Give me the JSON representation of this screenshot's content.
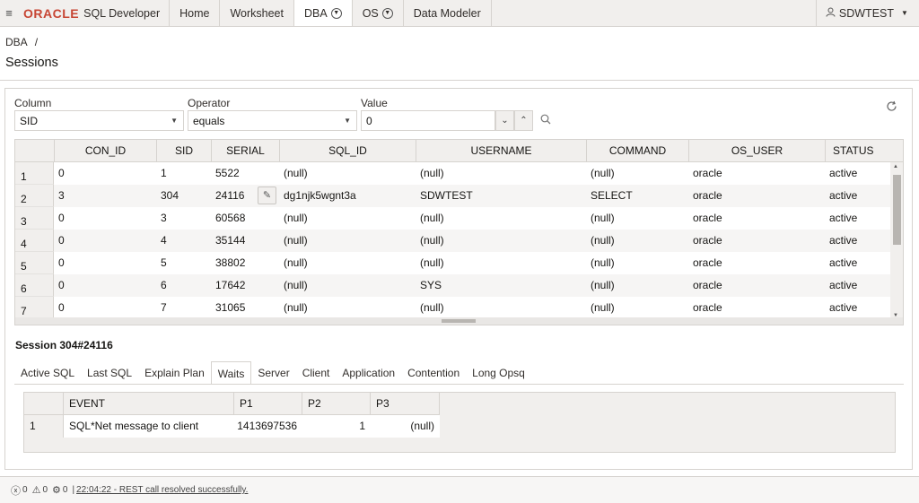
{
  "topbar": {
    "menu_icon": "hamburger-icon",
    "brand": "ORACLE",
    "product": "SQL Developer",
    "tabs": [
      {
        "label": "Home"
      },
      {
        "label": "Worksheet"
      },
      {
        "label": "DBA"
      },
      {
        "label": "OS"
      },
      {
        "label": "Data Modeler"
      }
    ],
    "user": "SDWTEST"
  },
  "breadcrumb": {
    "root": "DBA",
    "separator": "/"
  },
  "page_title": "Sessions",
  "filter": {
    "column_label": "Column",
    "column_value": "SID",
    "operator_label": "Operator",
    "operator_value": "equals",
    "value_label": "Value",
    "value_value": "0"
  },
  "sessions_grid": {
    "columns": [
      "CON_ID",
      "SID",
      "SERIAL",
      "SQL_ID",
      "USERNAME",
      "COMMAND",
      "OS_USER",
      "STATUS"
    ],
    "rows": [
      {
        "num": "1",
        "con_id": "0",
        "sid": "1",
        "serial": "5522",
        "sql_id": "(null)",
        "username": "(null)",
        "command": "(null)",
        "os_user": "oracle",
        "status": "active"
      },
      {
        "num": "2",
        "con_id": "3",
        "sid": "304",
        "serial": "24116",
        "sql_id": "dg1njk5wgnt3a",
        "username": "SDWTEST",
        "command": "SELECT",
        "os_user": "oracle",
        "status": "active"
      },
      {
        "num": "3",
        "con_id": "0",
        "sid": "3",
        "serial": "60568",
        "sql_id": "(null)",
        "username": "(null)",
        "command": "(null)",
        "os_user": "oracle",
        "status": "active"
      },
      {
        "num": "4",
        "con_id": "0",
        "sid": "4",
        "serial": "35144",
        "sql_id": "(null)",
        "username": "(null)",
        "command": "(null)",
        "os_user": "oracle",
        "status": "active"
      },
      {
        "num": "5",
        "con_id": "0",
        "sid": "5",
        "serial": "38802",
        "sql_id": "(null)",
        "username": "(null)",
        "command": "(null)",
        "os_user": "oracle",
        "status": "active"
      },
      {
        "num": "6",
        "con_id": "0",
        "sid": "6",
        "serial": "17642",
        "sql_id": "(null)",
        "username": "SYS",
        "command": "(null)",
        "os_user": "oracle",
        "status": "active"
      },
      {
        "num": "7",
        "con_id": "0",
        "sid": "7",
        "serial": "31065",
        "sql_id": "(null)",
        "username": "(null)",
        "command": "(null)",
        "os_user": "oracle",
        "status": "active"
      }
    ]
  },
  "session_detail": {
    "title": "Session 304#24116",
    "tabs": [
      {
        "label": "Active SQL"
      },
      {
        "label": "Last SQL"
      },
      {
        "label": "Explain Plan"
      },
      {
        "label": "Waits"
      },
      {
        "label": "Server"
      },
      {
        "label": "Client"
      },
      {
        "label": "Application"
      },
      {
        "label": "Contention"
      },
      {
        "label": "Long Opsq"
      }
    ],
    "active_tab": "Waits",
    "waits": {
      "columns": [
        "EVENT",
        "P1",
        "P2",
        "P3"
      ],
      "rows": [
        {
          "num": "1",
          "event": "SQL*Net message to client",
          "p1": "1413697536",
          "p2": "1",
          "p3": "(null)"
        }
      ]
    }
  },
  "statusbar": {
    "errors": "0",
    "warnings": "0",
    "settings": "0",
    "separator": "|",
    "message": "22:04:22 - REST call resolved successfully."
  },
  "colors": {
    "oracle_red": "#c74634",
    "border": "#d6d3cf",
    "header_bg": "#f1efed"
  }
}
